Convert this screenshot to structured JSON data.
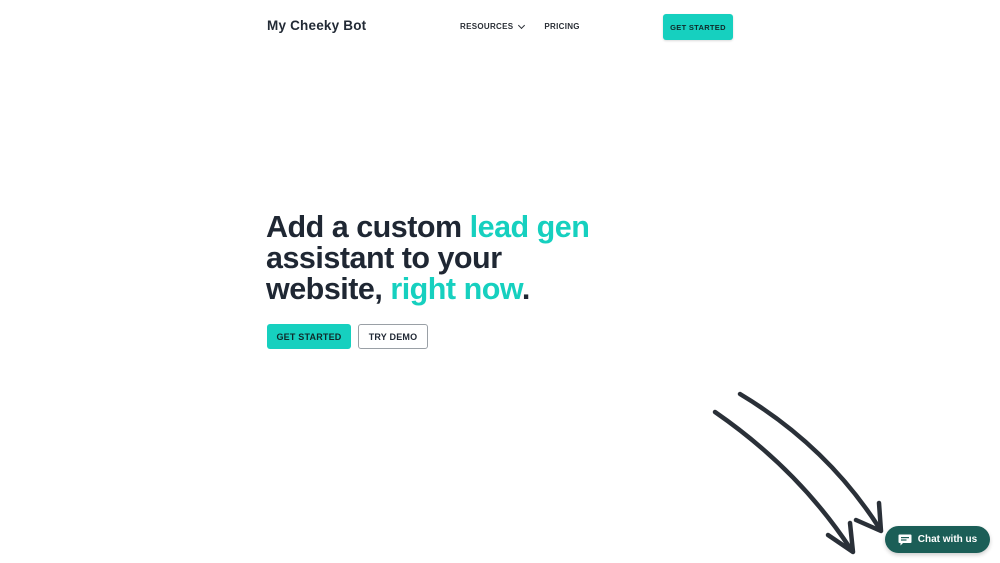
{
  "nav": {
    "brand": "My Cheeky Bot",
    "links": [
      {
        "label": "RESOURCES",
        "has_dropdown": true
      },
      {
        "label": "PRICING",
        "has_dropdown": false
      }
    ],
    "cta_label": "GET STARTED"
  },
  "hero": {
    "headline_line1_plain": "Add a custom ",
    "headline_line1_accent": "lead gen",
    "headline_line2_plain": "assistant to your",
    "headline_line3_plain": "website, ",
    "headline_line3_accent": "right now",
    "headline_line3_end": ".",
    "primary_button": "GET STARTED",
    "secondary_button": "TRY DEMO"
  },
  "chat": {
    "label": "Chat with us",
    "icon": "chat-bubble-icon"
  },
  "colors": {
    "accent": "#16d0bf",
    "text": "#1f2733",
    "chat_bg": "#1b5e57"
  }
}
